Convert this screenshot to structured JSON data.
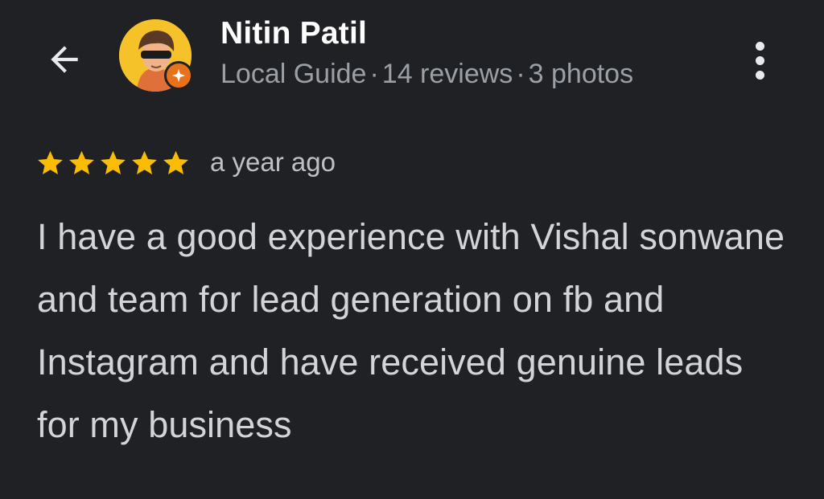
{
  "header": {
    "back_icon": "arrow-back-icon",
    "reviewer_name": "Nitin Patil",
    "meta": {
      "level": "Local Guide",
      "reviews": "14 reviews",
      "photos": "3 photos",
      "separator": "·"
    },
    "more_icon": "more-vert-icon"
  },
  "review": {
    "rating": 5,
    "rating_max": 5,
    "time_ago": "a year ago",
    "text": "I have a good experience with Vishal sonwane and team for lead generation on fb and Instagram and have received genuine leads for my business"
  },
  "colors": {
    "background": "#202124",
    "star": "#fbbc04",
    "badge": "#e8711c",
    "name": "#ffffff",
    "meta": "#9aa0a6"
  }
}
